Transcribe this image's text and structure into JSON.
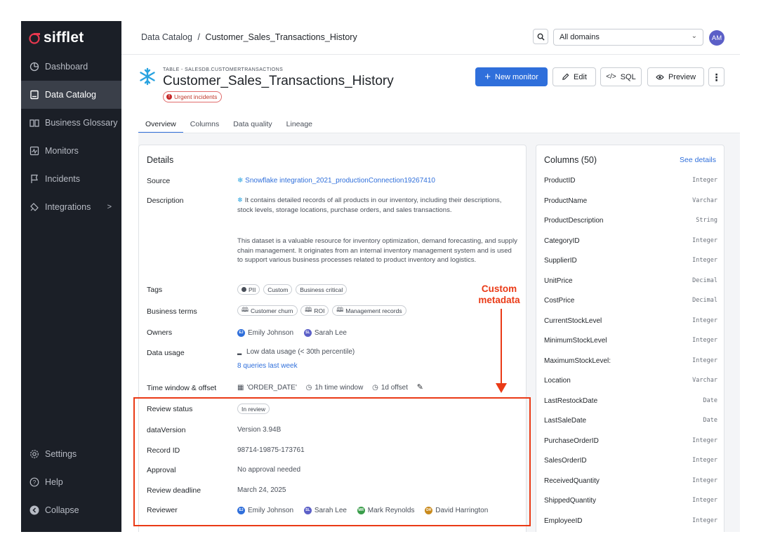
{
  "app": {
    "logo_text": "sifflet"
  },
  "sidebar": {
    "items": [
      {
        "label": "Dashboard",
        "icon": "dashboard-icon"
      },
      {
        "label": "Data Catalog",
        "icon": "catalog-icon",
        "active": true
      },
      {
        "label": "Business Glossary",
        "icon": "book-icon"
      },
      {
        "label": "Monitors",
        "icon": "monitor-icon"
      },
      {
        "label": "Incidents",
        "icon": "flag-icon"
      },
      {
        "label": "Integrations",
        "icon": "plug-icon",
        "chevron": ">"
      }
    ],
    "bottom": [
      {
        "label": "Settings",
        "icon": "gear-icon"
      },
      {
        "label": "Help",
        "icon": "help-icon"
      },
      {
        "label": "Collapse",
        "icon": "collapse-icon"
      }
    ]
  },
  "topbar": {
    "breadcrumb_root": "Data Catalog",
    "breadcrumb_sep": "/",
    "breadcrumb_current": "Customer_Sales_Transactions_History",
    "domain_value": "All domains",
    "avatar_initials": "AM"
  },
  "header": {
    "type_label": "TABLE - SALESDB.CUSTOMERTRANSACTIONS",
    "title": "Customer_Sales_Transactions_History",
    "urgent_badge": "Urgent incidents",
    "buttons": {
      "new_monitor": "New monitor",
      "edit": "Edit",
      "sql": "SQL",
      "preview": "Preview"
    }
  },
  "tabs": [
    "Overview",
    "Columns",
    "Data quality",
    "Lineage"
  ],
  "details": {
    "title": "Details",
    "labels": {
      "source": "Source",
      "description": "Description",
      "tags": "Tags",
      "business_terms": "Business terms",
      "owners": "Owners",
      "data_usage": "Data usage",
      "time_window": "Time window & offset",
      "review_status": "Review status",
      "data_version": "dataVersion",
      "record_id": "Record ID",
      "approval": "Approval",
      "review_deadline": "Review deadline",
      "reviewer": "Reviewer"
    },
    "source": "Snowflake integration_2021_productionConnection19267410",
    "description_p1": "It contains detailed records of all products in our inventory, including their descriptions, stock levels, storage locations, purchase orders, and sales transactions.",
    "description_p2": "This dataset is a valuable resource for inventory optimization, demand forecasting, and supply chain management. It originates from an internal inventory management system and is used to support various business processes related to product inventory and logistics.",
    "tags": [
      "PII",
      "Custom",
      "Business critical"
    ],
    "business_terms": [
      "Customer churn",
      "ROI",
      "Management records"
    ],
    "owners": [
      {
        "initials": "EJ",
        "name": "Emily Johnson",
        "color": "#2f6fdb"
      },
      {
        "initials": "SL",
        "name": "Sarah Lee",
        "color": "#5b5fc7"
      }
    ],
    "data_usage": "Low data usage (< 30th percentile)",
    "queries": "8 queries last week",
    "time_window": {
      "field": "'ORDER_DATE'",
      "window": "1h time window",
      "offset": "1d offset"
    },
    "review_status": "In review",
    "data_version": "Version 3.94B",
    "record_id": "98714-19875-173761",
    "approval": "No approval needed",
    "review_deadline": "March 24, 2025",
    "reviewers": [
      {
        "initials": "EJ",
        "name": "Emily Johnson",
        "color": "#2f6fdb"
      },
      {
        "initials": "SL",
        "name": "Sarah Lee",
        "color": "#5b5fc7"
      },
      {
        "initials": "MR",
        "name": "Mark Reynolds",
        "color": "#3a9d4a"
      },
      {
        "initials": "DH",
        "name": "David Harrington",
        "color": "#c98a1c"
      }
    ]
  },
  "annotation": {
    "line1": "Custom",
    "line2": "metadata",
    "color": "#ea3a16"
  },
  "columns": {
    "title": "Columns (50)",
    "see_details": "See details",
    "rows": [
      {
        "name": "ProductID",
        "type": "Integer"
      },
      {
        "name": "ProductName",
        "type": "Varchar"
      },
      {
        "name": "ProductDescription",
        "type": "String"
      },
      {
        "name": "CategoryID",
        "type": "Integer"
      },
      {
        "name": "SupplierID",
        "type": "Integer"
      },
      {
        "name": "UnitPrice",
        "type": "Decimal"
      },
      {
        "name": "CostPrice",
        "type": "Decimal"
      },
      {
        "name": "CurrentStockLevel",
        "type": "Integer"
      },
      {
        "name": "MinimumStockLevel",
        "type": "Integer"
      },
      {
        "name": "MaximumStockLevel:",
        "type": "Integer"
      },
      {
        "name": "Location",
        "type": "Varchar"
      },
      {
        "name": "LastRestockDate",
        "type": "Date"
      },
      {
        "name": "LastSaleDate",
        "type": "Date"
      },
      {
        "name": "PurchaseOrderID",
        "type": "Integer"
      },
      {
        "name": "SalesOrderID",
        "type": "Integer"
      },
      {
        "name": "ReceivedQuantity",
        "type": "Integer"
      },
      {
        "name": "ShippedQuantity",
        "type": "Integer"
      },
      {
        "name": "EmployeeID",
        "type": "Integer"
      }
    ]
  }
}
